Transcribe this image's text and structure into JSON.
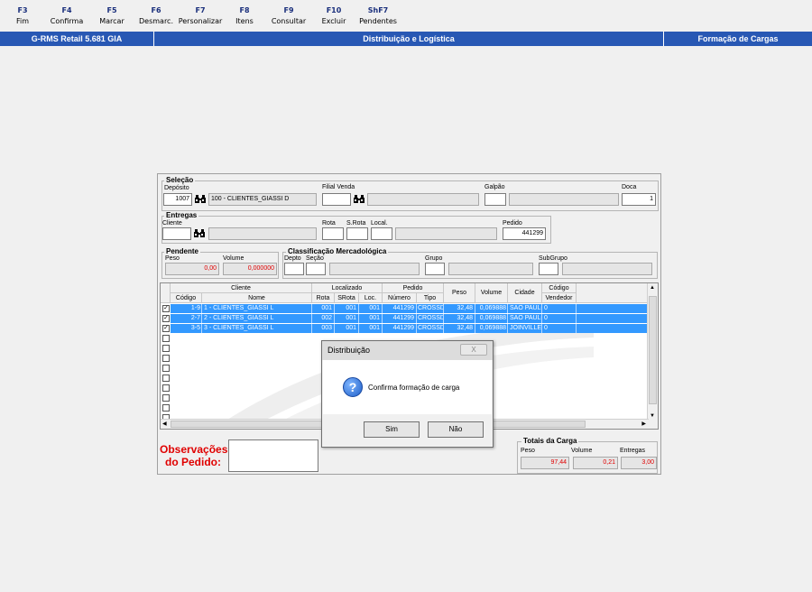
{
  "fkeys": [
    {
      "key": "F3",
      "label": "Fim"
    },
    {
      "key": "F4",
      "label": "Confirma"
    },
    {
      "key": "F5",
      "label": "Marcar"
    },
    {
      "key": "F6",
      "label": "Desmarc."
    },
    {
      "key": "F7",
      "label": "Personalizar"
    },
    {
      "key": "F8",
      "label": "Itens"
    },
    {
      "key": "F9",
      "label": "Consultar"
    },
    {
      "key": "F10",
      "label": "Excluir"
    },
    {
      "key": "ShF7",
      "label": "Pendentes"
    }
  ],
  "titlebar": {
    "app": "G-RMS Retail 5.681 GIA",
    "module": "Distribuição e Logística",
    "screen": "Formação de Cargas"
  },
  "selecao": {
    "legend": "Seleção",
    "deposito_label": "Depósito",
    "deposito_value": "1007",
    "deposito_name": "100 - CLIENTES_GIASSI D",
    "filial_label": "Filial Venda",
    "filial_value": "",
    "filial_name": "",
    "galpao_label": "Galpão",
    "doca_label": "Doca",
    "doca_value": "1"
  },
  "entregas": {
    "legend": "Entregas",
    "cliente_label": "Cliente",
    "rota_label": "Rota",
    "srota_label": "S.Rota",
    "local_label": "Local.",
    "pedido_label": "Pedido",
    "pedido_value": "441299"
  },
  "pendente": {
    "legend": "Pendente",
    "peso_label": "Peso",
    "peso_value": "0,00",
    "volume_label": "Volume",
    "volume_value": "0,000000"
  },
  "classificacao": {
    "legend": "Classificação Mercadológica",
    "depto_label": "Depto",
    "secao_label": "Seção",
    "grupo_label": "Grupo",
    "subgrupo_label": "SubGrupo"
  },
  "grid": {
    "group_headers": {
      "cliente": "Cliente",
      "localizado": "Localizado",
      "pedido": "Pedido",
      "codigo": "Código"
    },
    "headers": {
      "codigo": "Código",
      "nome": "Nome",
      "rota": "Rota",
      "srota": "SRota",
      "loc": "Loc.",
      "numero": "Número",
      "tipo": "Tipo",
      "peso": "Peso",
      "volume": "Volume",
      "cidade": "Cidade",
      "vendedor": "Vendedor"
    },
    "rows": [
      {
        "codigo": "1-9",
        "nome": "1 - CLIENTES_GIASSI L",
        "rota": "001",
        "srota": "001",
        "loc": "001",
        "numero": "441299",
        "tipo": "CROSSDO(",
        "peso": "32,48",
        "volume": "0,069888",
        "cidade": "SAO PAULO",
        "vendedor": "0"
      },
      {
        "codigo": "2-7",
        "nome": "2 - CLIENTES_GIASSI L",
        "rota": "002",
        "srota": "001",
        "loc": "001",
        "numero": "441299",
        "tipo": "CROSSDO(",
        "peso": "32,48",
        "volume": "0,069888",
        "cidade": "SAO PAULO",
        "vendedor": "0"
      },
      {
        "codigo": "3-5",
        "nome": "3 - CLIENTES_GIASSI L",
        "rota": "003",
        "srota": "001",
        "loc": "001",
        "numero": "441299",
        "tipo": "CROSSDO(",
        "peso": "32,48",
        "volume": "0,069888",
        "cidade": "JOINVILLE",
        "vendedor": "0"
      }
    ]
  },
  "observacoes": {
    "label_line1": "Observações",
    "label_line2": "do Pedido:"
  },
  "totais": {
    "legend": "Totais da Carga",
    "peso_label": "Peso",
    "peso_value": "97,44",
    "volume_label": "Volume",
    "volume_value": "0,21",
    "entregas_label": "Entregas",
    "entregas_value": "3,00"
  },
  "dialog": {
    "title": "Distribuição",
    "close": "X",
    "message": "Confirma formação de carga",
    "yes": "Sim",
    "no": "Não"
  },
  "colors": {
    "titlebar": "#2858b4",
    "selection": "#3399ff",
    "alert_red": "#e00000",
    "fkey_blue": "#1a2f7c"
  }
}
